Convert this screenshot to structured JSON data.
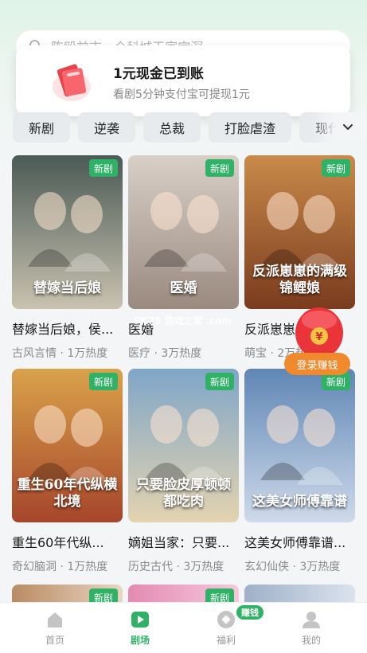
{
  "search": {
    "placeholder": "陈殴前市 . 仓科城王家宫溟"
  },
  "toast": {
    "title": "1元现金已到账",
    "subtitle": "看剧5分钟支付宝可提现1元"
  },
  "categories": [
    "新剧",
    "逆袭",
    "总裁",
    "打脸虐渣",
    "现代"
  ],
  "badge_new": "新剧",
  "dramas": [
    {
      "title": "替嫁当后娘，侯...",
      "meta": "古风言情 · 1万热度",
      "poster_text": "替嫁当后娘",
      "c1": "#4a5a55",
      "c2": "#c9c2b0"
    },
    {
      "title": "医婚",
      "meta": "医疗 · 3万热度",
      "poster_text": "医婚",
      "c1": "#d8cfc7",
      "c2": "#9a8a80"
    },
    {
      "title": "反派崽崽...",
      "meta": "萌宝 · 2万热度",
      "poster_text": "反派崽崽的满级锦鲤娘",
      "c1": "#c98a4a",
      "c2": "#7a3b1e"
    },
    {
      "title": "重生60年代纵...",
      "meta": "奇幻脑洞 · 1万热度",
      "poster_text": "重生60年代纵横北境",
      "c1": "#d9a24a",
      "c2": "#a6452b"
    },
    {
      "title": "嫡姐当家：只要...",
      "meta": "历史古代 · 3万热度",
      "poster_text": "只要脸皮厚顿顿都吃肉",
      "c1": "#7fa6c8",
      "c2": "#e4d3b0"
    },
    {
      "title": "这美女师傅靠谱...",
      "meta": "玄幻仙侠 · 3万热度",
      "poster_text": "这美女师傅靠谱",
      "c1": "#5f86b5",
      "c2": "#cfdaea"
    }
  ],
  "row3_posters": [
    {
      "c1": "#b98b63",
      "c2": "#e8d6c2"
    },
    {
      "c1": "#e48ab3",
      "c2": "#f6c8de"
    },
    {
      "c1": "#9fb0c8",
      "c2": "#dbe3ee"
    }
  ],
  "float": {
    "button": "登录赚钱"
  },
  "watermark": "9K73 游戏之家 .com",
  "nav": {
    "items": [
      "首页",
      "剧场",
      "福利",
      "我的"
    ],
    "active_index": 1,
    "earn_badge": "赚钱"
  },
  "colors": {
    "accent": "#2fb266",
    "orange": "#f08a2c"
  }
}
